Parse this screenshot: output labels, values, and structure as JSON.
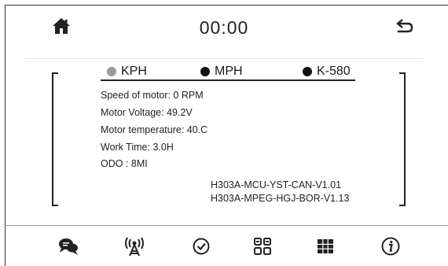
{
  "header": {
    "clock": "00:00"
  },
  "units": [
    {
      "label": "KPH",
      "color": "#9a9a9a"
    },
    {
      "label": "MPH",
      "color": "#111111"
    },
    {
      "label": "K-580",
      "color": "#111111"
    }
  ],
  "info": {
    "speed": "Speed of motor:  0 RPM",
    "voltage": "Motor Voltage:  49.2V",
    "temperature": "Motor temperature:  40.C",
    "work_time": "Work Time:  3.0H",
    "odo": "ODO :  8MI"
  },
  "versions": {
    "mcu": "H303A-MCU-YST-CAN-V1.01",
    "mpeg": "H303A-MPEG-HGJ-BOR-V1.13"
  },
  "nav_icons": [
    "chat-icon",
    "antenna-icon",
    "check-circle-icon",
    "apps-grid-icon",
    "keypad-grid-icon",
    "info-icon"
  ]
}
